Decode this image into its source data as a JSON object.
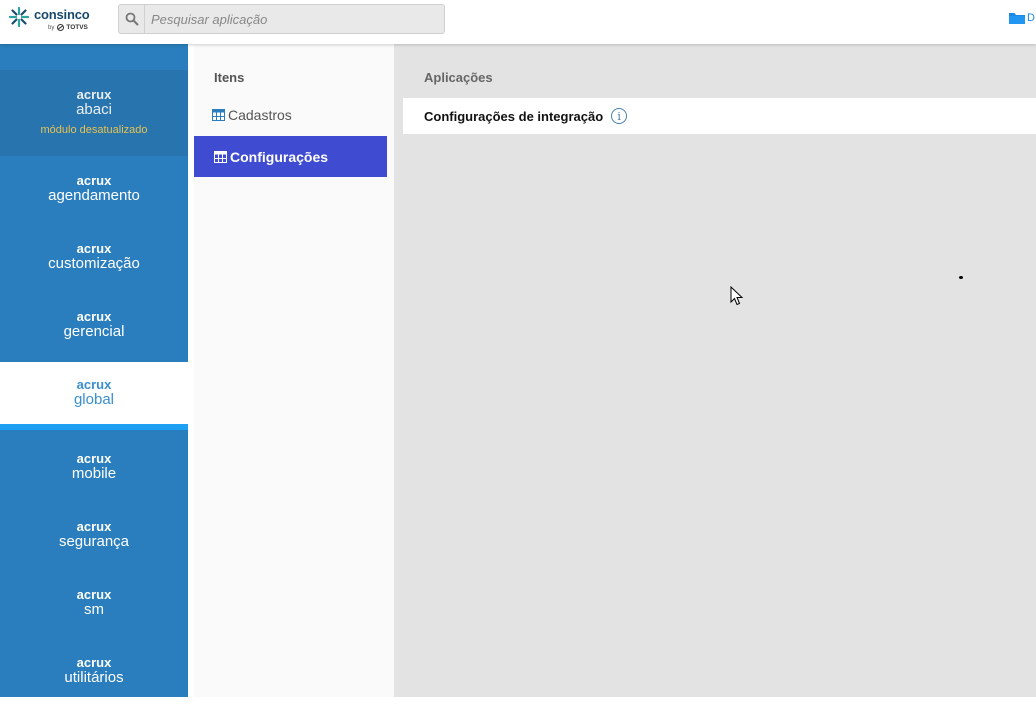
{
  "header": {
    "logo": {
      "name": "consinco",
      "by": "by",
      "partner": "TOTVS"
    },
    "search": {
      "placeholder": "Pesquisar aplicação",
      "value": ""
    },
    "folder_label": "D"
  },
  "sidebar": {
    "modules": [
      {
        "brand": "acrux",
        "name": "abaci",
        "warning": "módulo desatualizado"
      },
      {
        "brand": "acrux",
        "name": "agendamento"
      },
      {
        "brand": "acrux",
        "name": "customização"
      },
      {
        "brand": "acrux",
        "name": "gerencial"
      },
      {
        "brand": "acrux",
        "name": "global",
        "active": true
      },
      {
        "brand": "acrux",
        "name": "mobile"
      },
      {
        "brand": "acrux",
        "name": "segurança"
      },
      {
        "brand": "acrux",
        "name": "sm"
      },
      {
        "brand": "acrux",
        "name": "utilitários"
      }
    ]
  },
  "items": {
    "title": "Itens",
    "list": [
      {
        "label": "Cadastros",
        "active": false
      },
      {
        "label": "Configurações",
        "active": true
      }
    ]
  },
  "main": {
    "title": "Aplicações",
    "apps": [
      {
        "label": "Configurações de integração"
      }
    ]
  },
  "colors": {
    "sidebar": "#2a7ebd",
    "sidebar_accent": "#1e9ff2",
    "active_item": "#3f4bd0",
    "warning": "#e6c352"
  }
}
